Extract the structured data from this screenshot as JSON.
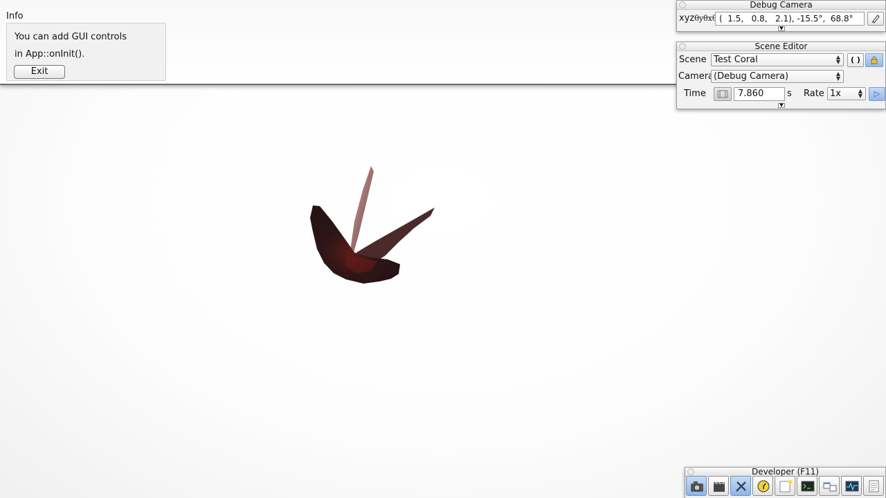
{
  "info": {
    "title": "Info",
    "line1": "You can add GUI controls",
    "line2": "in App::onInit().",
    "exit_label": "Exit"
  },
  "debug_camera": {
    "title": "Debug Camera",
    "xyz_label": "xyz",
    "angle_label": "θyθxθz",
    "value": "(  1.5,   0.8,   2.1), -15.5°,  68.8°"
  },
  "scene_editor": {
    "title": "Scene Editor",
    "scene_label": "Scene",
    "scene_value": "Test Coral",
    "camera_label": "Camera",
    "camera_value": "(Debug Camera)",
    "time_label": "Time",
    "time_value": "7.860",
    "time_unit": "s",
    "rate_label": "Rate",
    "rate_value": "1x"
  },
  "developer": {
    "title": "Developer (F11)",
    "buttons": [
      "camera-icon",
      "clapperboard-icon",
      "tools-icon",
      "clock-icon",
      "notepad-icon",
      "terminal-icon",
      "windows-icon",
      "profiler-icon",
      "document-icon"
    ]
  },
  "colors": {
    "accent_blue": "#91b8e8",
    "coral_dark": "#2a1416",
    "coral_red": "#7a2a24"
  }
}
